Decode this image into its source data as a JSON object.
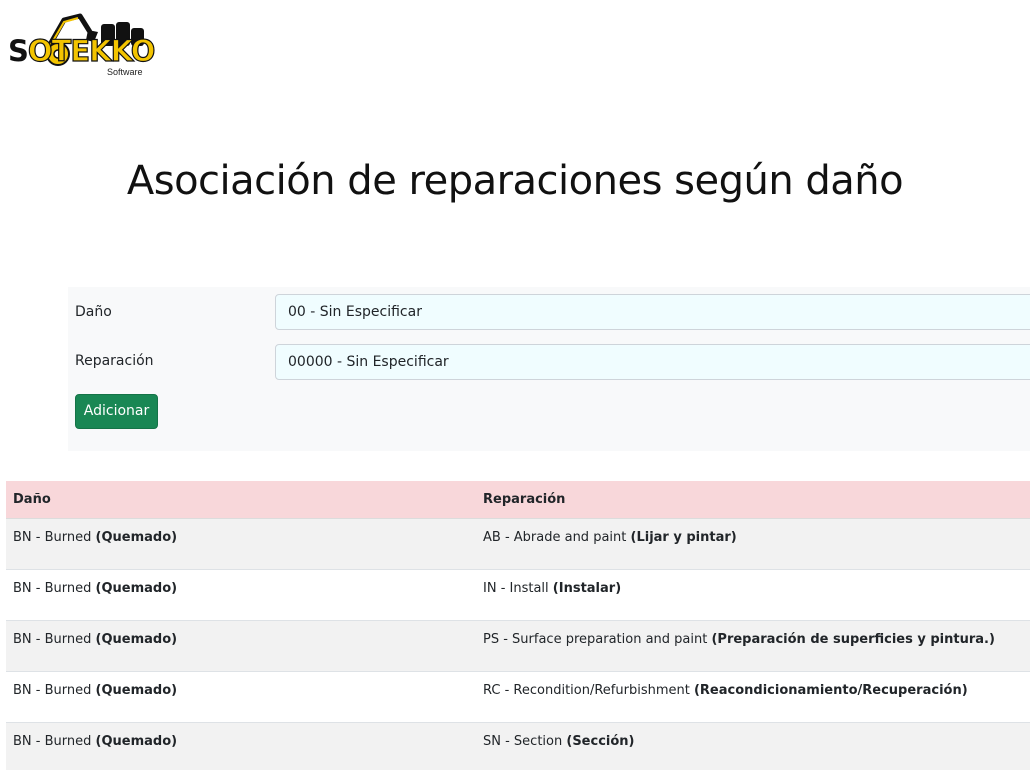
{
  "logo": {
    "word_prefix": "S",
    "word_main": "OTEKKO",
    "subtitle": "Software",
    "brand_color": "#f3c400"
  },
  "page": {
    "title": "Asociación de reparaciones según daño"
  },
  "form": {
    "damage_label": "Daño",
    "damage_value": "00 - Sin Especificar",
    "repair_label": "Reparación",
    "repair_value": "00000 - Sin Especificar",
    "add_button_label": "Adicionar",
    "button_color": "#198754",
    "input_bg_color": "#f0fdff"
  },
  "table": {
    "header_color": "#f8d7da",
    "columns": [
      "Daño",
      "Reparación"
    ],
    "rows": [
      {
        "damage": "BN - Burned",
        "damage_es": "(Quemado)",
        "repair": "AB - Abrade and paint",
        "repair_es": "(Lijar y pintar)"
      },
      {
        "damage": "BN - Burned",
        "damage_es": "(Quemado)",
        "repair": "IN - Install",
        "repair_es": "(Instalar)"
      },
      {
        "damage": "BN - Burned",
        "damage_es": "(Quemado)",
        "repair": "PS - Surface preparation and paint",
        "repair_es": "(Preparación de superficies y pintura.)"
      },
      {
        "damage": "BN - Burned",
        "damage_es": "(Quemado)",
        "repair": "RC - Recondition/Refurbishment",
        "repair_es": "(Reacondicionamiento/Recuperación)"
      },
      {
        "damage": "BN - Burned",
        "damage_es": "(Quemado)",
        "repair": "SN - Section",
        "repair_es": "(Sección)"
      }
    ]
  }
}
